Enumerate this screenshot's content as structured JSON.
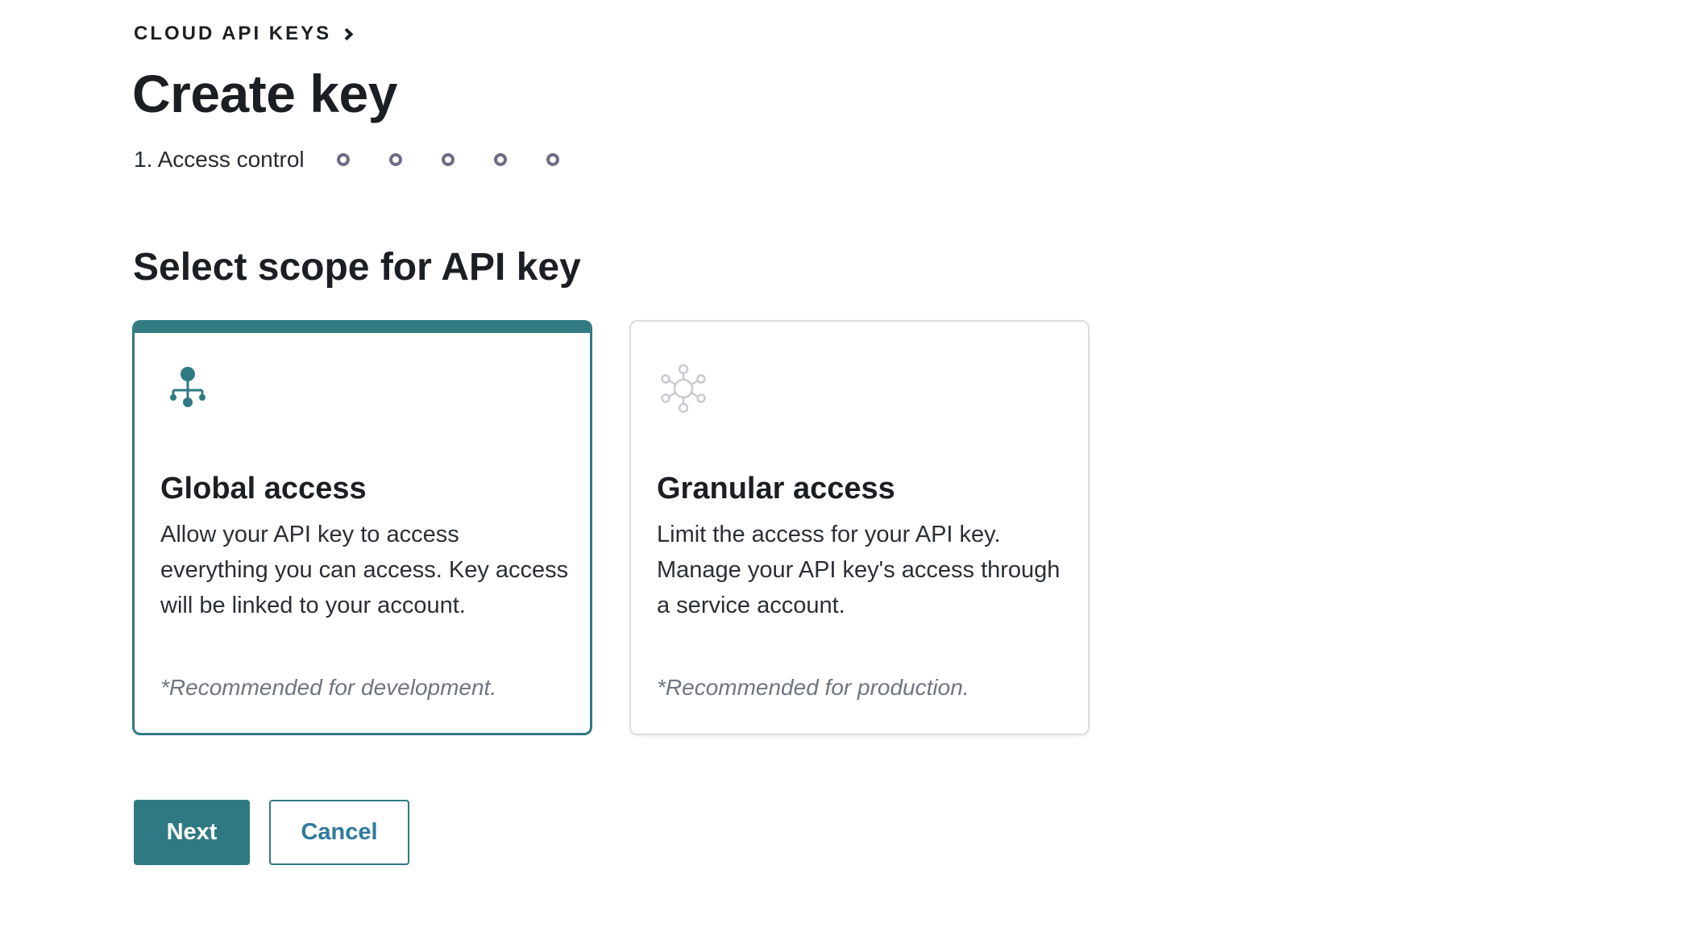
{
  "breadcrumb": {
    "label": "CLOUD API KEYS"
  },
  "header": {
    "title": "Create key"
  },
  "stepper": {
    "current_step_label": "1. Access control",
    "remaining_steps": 5
  },
  "main": {
    "section_title": "Select scope for API key",
    "options": [
      {
        "title": "Global access",
        "description": "Allow your API key to access everything you can access. Key access will be linked to your account.",
        "note": "*Recommended for development.",
        "selected": true,
        "icon": "hierarchy-icon"
      },
      {
        "title": "Granular access",
        "description": "Limit the access for your API key. Manage your API key's access through a service account.",
        "note": "*Recommended for production.",
        "selected": false,
        "icon": "network-hub-icon"
      }
    ]
  },
  "actions": {
    "next_label": "Next",
    "cancel_label": "Cancel"
  },
  "colors": {
    "accent": "#2f7a82",
    "step_dot": "#6f6b86",
    "note_text": "#6f7580"
  }
}
